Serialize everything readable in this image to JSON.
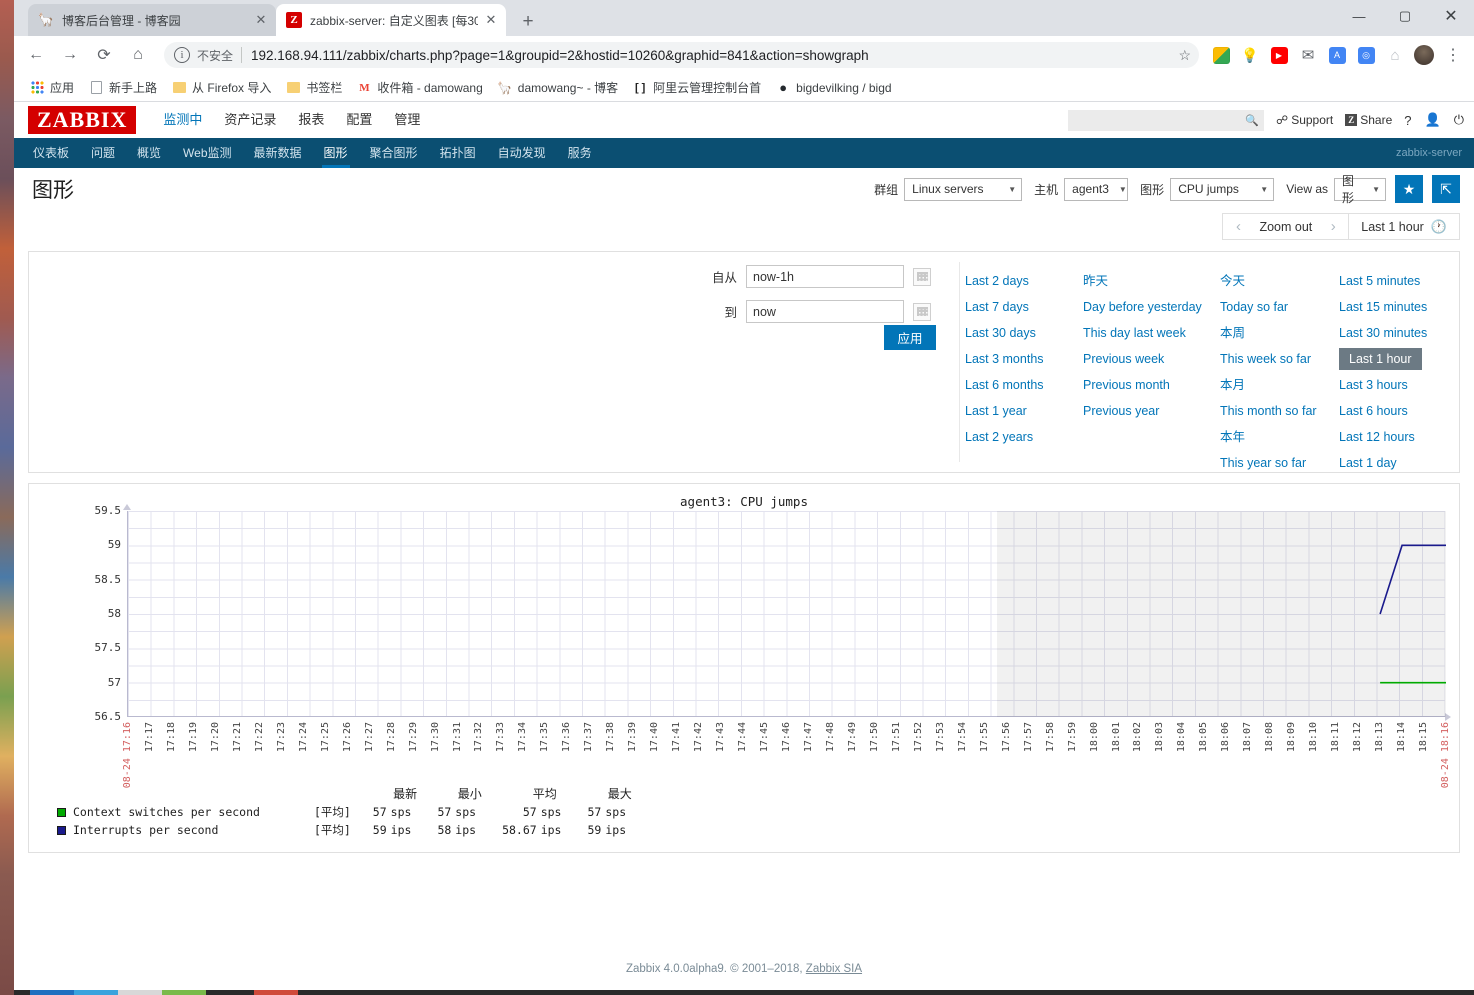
{
  "browser": {
    "tabs": [
      {
        "title": "博客后台管理 - 博客园",
        "favicon": "blog-icon",
        "active": false
      },
      {
        "title": "zabbix-server: 自定义图表 [每30",
        "favicon": "zabbix-icon",
        "active": true
      }
    ],
    "new_tab_label": "+",
    "window_controls": {
      "minimize": "—",
      "maximize": "▢",
      "close": "✕"
    },
    "nav": {
      "back": "←",
      "forward": "→",
      "reload": "⟳",
      "home": "⌂",
      "not_secure": "不安全",
      "url": "192.168.94.111/zabbix/charts.php?page=1&groupid=2&hostid=10260&graphid=841&action=showgraph",
      "star": "☆",
      "menu": "⋮"
    },
    "bookmarks": [
      {
        "label": "应用",
        "icon": "apps-grid-icon"
      },
      {
        "label": "新手上路",
        "icon": "document-icon"
      },
      {
        "label": "从 Firefox 导入",
        "icon": "folder-icon"
      },
      {
        "label": "书签栏",
        "icon": "folder-icon"
      },
      {
        "label": "收件箱 - damowang",
        "icon": "gmail-icon"
      },
      {
        "label": "damowang~ - 博客",
        "icon": "blog-icon"
      },
      {
        "label": "阿里云管理控制台首",
        "icon": "aliyun-icon"
      },
      {
        "label": "bigdevilking / bigd",
        "icon": "github-icon"
      }
    ]
  },
  "zabbix": {
    "logo": "ZABBIX",
    "server_name": "zabbix-server",
    "topnav": [
      {
        "label": "监测中",
        "selected": true
      },
      {
        "label": "资产记录",
        "selected": false
      },
      {
        "label": "报表",
        "selected": false
      },
      {
        "label": "配置",
        "selected": false
      },
      {
        "label": "管理",
        "selected": false
      }
    ],
    "subnav": [
      {
        "label": "仪表板",
        "selected": false
      },
      {
        "label": "问题",
        "selected": false
      },
      {
        "label": "概览",
        "selected": false
      },
      {
        "label": "Web监测",
        "selected": false
      },
      {
        "label": "最新数据",
        "selected": false
      },
      {
        "label": "图形",
        "selected": true
      },
      {
        "label": "聚合图形",
        "selected": false
      },
      {
        "label": "拓扑图",
        "selected": false
      },
      {
        "label": "自动发现",
        "selected": false
      },
      {
        "label": "服务",
        "selected": false
      }
    ],
    "header_actions": {
      "search_placeholder": "",
      "search_value": "",
      "support": "Support",
      "share": "Share",
      "share_badge": "Z",
      "help": "?",
      "user": "user-icon",
      "signout": "power-icon"
    },
    "page_title": "图形",
    "selectors": {
      "group_label": "群组",
      "group_value": "Linux servers",
      "host_label": "主机",
      "host_value": "agent3",
      "graph_label": "图形",
      "graph_value": "CPU jumps",
      "viewas_label": "View as",
      "viewas_value": "图形",
      "favorite_icon": "star-icon",
      "fullscreen_icon": "expand-icon"
    },
    "timebar": {
      "prev": "‹",
      "zoom_out": "Zoom out",
      "next": "›",
      "active_range": "Last 1 hour",
      "clock_icon": "clock-icon"
    },
    "filter": {
      "from_label": "自从",
      "from_value": "now-1h",
      "to_label": "到",
      "to_value": "now",
      "apply_label": "应用",
      "calendar_icon": "calendar-icon",
      "quick_ranges": {
        "col1": [
          "Last 2 days",
          "Last 7 days",
          "Last 30 days",
          "Last 3 months",
          "Last 6 months",
          "Last 1 year",
          "Last 2 years"
        ],
        "col2": [
          "昨天",
          "Day before yesterday",
          "This day last week",
          "Previous week",
          "Previous month",
          "Previous year"
        ],
        "col3": [
          "今天",
          "Today so far",
          "本周",
          "This week so far",
          "本月",
          "This month so far",
          "本年",
          "This year so far"
        ],
        "col4": [
          "Last 5 minutes",
          "Last 15 minutes",
          "Last 30 minutes",
          "Last 1 hour",
          "Last 3 hours",
          "Last 6 hours",
          "Last 12 hours",
          "Last 1 day"
        ],
        "selected": "Last 1 hour"
      }
    },
    "footer": {
      "text": "Zabbix 4.0.0alpha9. © 2001–2018, ",
      "link": "Zabbix SIA"
    }
  },
  "chart_data": {
    "type": "line",
    "title": "agent3: CPU jumps",
    "xlabel": "",
    "ylabel": "",
    "ylim": [
      56.5,
      59.5
    ],
    "ytick_labels": [
      "59.5",
      "59",
      "58.5",
      "58",
      "57.5",
      "57",
      "56.5"
    ],
    "ytick_values": [
      59.5,
      59,
      58.5,
      58,
      57.5,
      57,
      56.5
    ],
    "grid": true,
    "x_start_label": "08-24 17:16",
    "x_end_label": "08-24 18:16",
    "xtick_labels": [
      "08-24 17:16",
      "17:17",
      "17:18",
      "17:19",
      "17:20",
      "17:21",
      "17:22",
      "17:23",
      "17:24",
      "17:25",
      "17:26",
      "17:27",
      "17:28",
      "17:29",
      "17:30",
      "17:31",
      "17:32",
      "17:33",
      "17:34",
      "17:35",
      "17:36",
      "17:37",
      "17:38",
      "17:39",
      "17:40",
      "17:41",
      "17:42",
      "17:43",
      "17:44",
      "17:45",
      "17:46",
      "17:47",
      "17:48",
      "17:49",
      "17:50",
      "17:51",
      "17:52",
      "17:53",
      "17:54",
      "17:55",
      "17:56",
      "17:57",
      "17:58",
      "17:59",
      "18:00",
      "18:01",
      "18:02",
      "18:03",
      "18:04",
      "18:05",
      "18:06",
      "18:07",
      "18:08",
      "18:09",
      "18:10",
      "18:11",
      "18:12",
      "18:13",
      "18:14",
      "18:15",
      "08-24 18:16"
    ],
    "series": [
      {
        "name": "Context switches per second",
        "color": "#00aa00",
        "aggregate": "[平均]",
        "unit": "sps",
        "last": "57",
        "min": "57",
        "avg": "57",
        "max": "57",
        "points": [
          {
            "x": "18:13",
            "y": 57
          },
          {
            "x": "18:16",
            "y": 57
          }
        ]
      },
      {
        "name": "Interrupts per second",
        "color": "#1a1a8c",
        "aggregate": "[平均]",
        "unit": "ips",
        "last": "59",
        "min": "58",
        "avg": "58.67",
        "max": "59",
        "points": [
          {
            "x": "18:13",
            "y": 58
          },
          {
            "x": "18:14",
            "y": 59
          },
          {
            "x": "18:16",
            "y": 59
          }
        ]
      }
    ],
    "legend_columns": [
      "最新",
      "最小",
      "平均",
      "最大"
    ],
    "shaded_region": {
      "from": "18:00",
      "to": "18:16"
    }
  }
}
